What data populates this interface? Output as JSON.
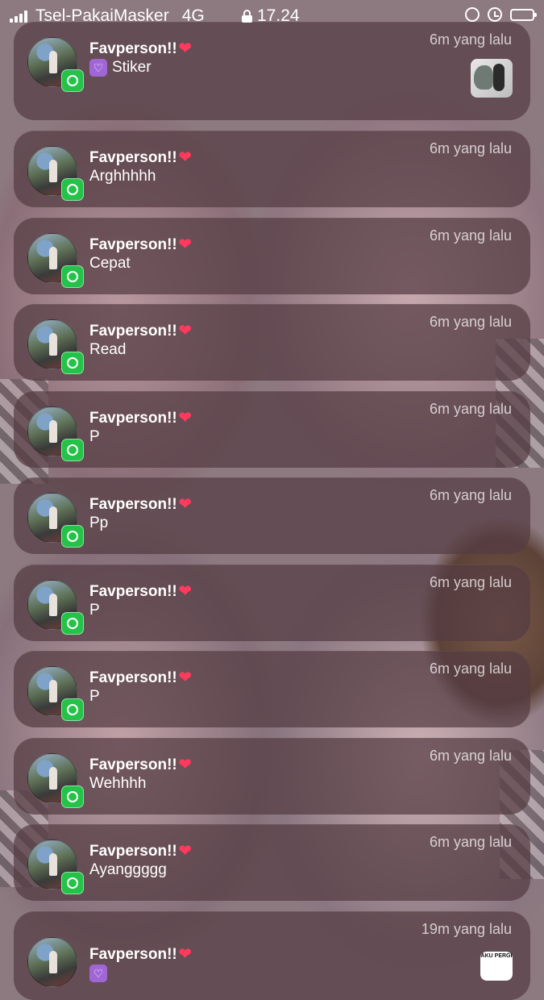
{
  "status_bar": {
    "carrier": "Tsel-PakaiMasker",
    "network": "4G",
    "time": "17.24"
  },
  "notifications": [
    {
      "sender": "Favperson!!",
      "message": "Stiker",
      "time": "6m yang lalu",
      "sticker": true
    },
    {
      "sender": "Favperson!!",
      "message": "Arghhhhh",
      "time": "6m yang lalu"
    },
    {
      "sender": "Favperson!!",
      "message": "Cepat",
      "time": "6m yang lalu"
    },
    {
      "sender": "Favperson!!",
      "message": "Read",
      "time": "6m yang lalu"
    },
    {
      "sender": "Favperson!!",
      "message": "P",
      "time": "6m yang lalu"
    },
    {
      "sender": "Favperson!!",
      "message": "Pp",
      "time": "6m yang lalu"
    },
    {
      "sender": "Favperson!!",
      "message": "P",
      "time": "6m yang lalu"
    },
    {
      "sender": "Favperson!!",
      "message": "P",
      "time": "6m yang lalu"
    },
    {
      "sender": "Favperson!!",
      "message": "Wehhhh",
      "time": "6m yang lalu"
    },
    {
      "sender": "Favperson!!",
      "message": "Ayanggggg",
      "time": "6m yang lalu"
    },
    {
      "sender": "Favperson!!",
      "message": "",
      "time": "19m yang lalu",
      "sticker": true,
      "sticker_text": "AKU PERGI"
    }
  ],
  "icons": {
    "app": "whatsapp-icon",
    "heart": "heart-emoji",
    "sticker": "purple-heart-emoji"
  }
}
